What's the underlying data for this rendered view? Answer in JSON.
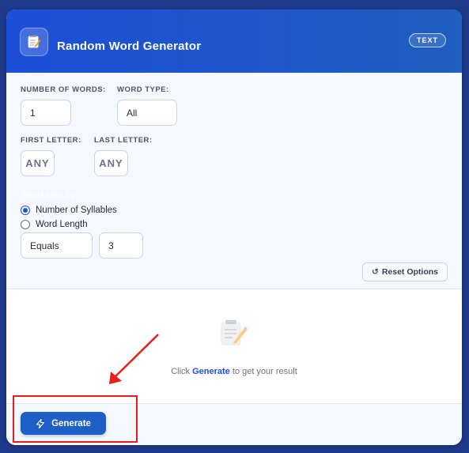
{
  "header": {
    "title": "Random Word Generator",
    "badge": "TEXT",
    "icon": "notepad-icon"
  },
  "options": {
    "number_of_words": {
      "label": "NUMBER OF WORDS:",
      "value": "1"
    },
    "word_type": {
      "label": "WORD TYPE:",
      "value": "All"
    },
    "first_letter": {
      "label": "FIRST LETTER:",
      "value": "ANY"
    },
    "last_letter": {
      "label": "LAST LETTER:",
      "value": "ANY"
    },
    "word_size": {
      "label": "Word size by:",
      "options": [
        "Number of Syllables",
        "Word Length"
      ],
      "selected": "Number of Syllables",
      "comparator": "Equals",
      "amount": "3"
    },
    "reset_label": "Reset Options"
  },
  "result": {
    "hint_prefix": "Click",
    "hint_action": "Generate",
    "hint_suffix": "to get your result"
  },
  "footer": {
    "generate_label": "Generate"
  },
  "colors": {
    "accent": "#1d4ed8",
    "annotation": "#ea1c1c"
  }
}
